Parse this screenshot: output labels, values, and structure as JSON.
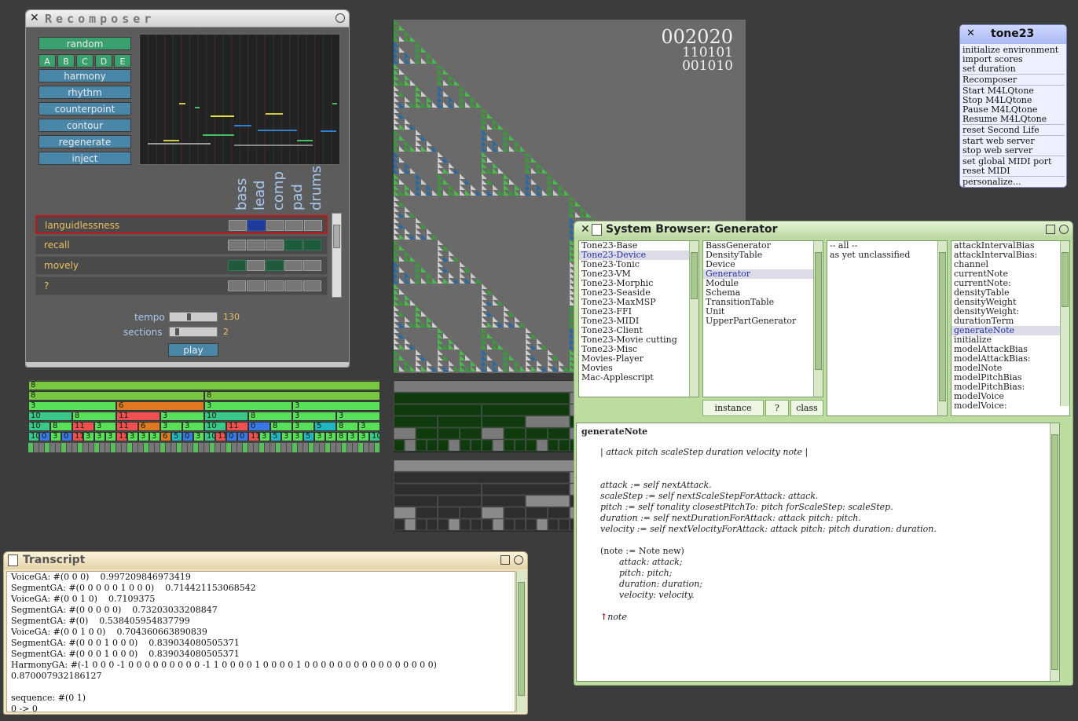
{
  "recomposer": {
    "title": "Recomposer",
    "buttons": [
      "random",
      "harmony",
      "rhythm",
      "counterpoint",
      "contour",
      "regenerate",
      "inject"
    ],
    "letters": [
      "A",
      "B",
      "C",
      "D",
      "E"
    ],
    "instruments": [
      "bass",
      "lead",
      "comp",
      "pad",
      "drums"
    ],
    "tracks": [
      {
        "name": "languidlessness",
        "cells": [
          0,
          2,
          0,
          0,
          0
        ]
      },
      {
        "name": "recall",
        "cells": [
          0,
          0,
          0,
          1,
          1
        ]
      },
      {
        "name": "movely",
        "cells": [
          1,
          0,
          1,
          0,
          0
        ]
      },
      {
        "name": "?",
        "cells": [
          0,
          0,
          0,
          0,
          0
        ]
      }
    ],
    "tempo_label": "tempo",
    "tempo_value": "130",
    "sections_label": "sections",
    "sections_value": "2",
    "play_label": "play",
    "colors": {
      "button_green": "#3aa06e",
      "button_blue": "#4a86a8",
      "value_gold": "#e8c060",
      "label_blue": "#a8c8ee"
    }
  },
  "counter": {
    "line1": "002020",
    "line2": "110101",
    "line3": "001010"
  },
  "segments": {
    "rows": [
      [
        [
          "8",
          448,
          "#78c840"
        ]
      ],
      [
        [
          "8",
          224,
          "#78c840"
        ],
        [
          "8",
          224,
          "#78c840"
        ]
      ],
      [
        [
          "3",
          112,
          "#58e058"
        ],
        [
          "6",
          112,
          "#e07820"
        ],
        [
          "3",
          112,
          "#58e058"
        ],
        [
          "3",
          112,
          "#58e058"
        ]
      ],
      [
        [
          "10",
          56,
          "#38c888"
        ],
        [
          "8",
          56,
          "#58e058"
        ],
        [
          "11",
          56,
          "#f05050"
        ],
        [
          "3",
          56,
          "#58e058"
        ],
        [
          "10",
          56,
          "#38c888"
        ],
        [
          "8",
          56,
          "#58e058"
        ],
        [
          "3",
          56,
          "#58e058"
        ],
        [
          "3",
          56,
          "#58e058"
        ]
      ],
      [
        [
          "10",
          28,
          "#38c888"
        ],
        [
          "8",
          28,
          "#58e058"
        ],
        [
          "11",
          28,
          "#f05050"
        ],
        [
          "3",
          28,
          "#58e058"
        ],
        [
          "11",
          28,
          "#f05050"
        ],
        [
          "6",
          28,
          "#e07820"
        ],
        [
          "3",
          28,
          "#58e058"
        ],
        [
          "3",
          28,
          "#58e058"
        ],
        [
          "10",
          28,
          "#38c888"
        ],
        [
          "11",
          28,
          "#f05050"
        ],
        [
          "0",
          28,
          "#3878e8"
        ],
        [
          "8",
          28,
          "#58e058"
        ],
        [
          "3",
          28,
          "#58e058"
        ],
        [
          "5",
          28,
          "#20b8c0"
        ],
        [
          "8",
          28,
          "#58e058"
        ],
        [
          "3",
          28,
          "#58e058"
        ]
      ],
      [
        [
          "10",
          14,
          "#38c888"
        ],
        [
          "0",
          14,
          "#3878e8"
        ],
        [
          "3",
          14,
          "#58e058"
        ],
        [
          "0",
          14,
          "#3878e8"
        ],
        [
          "11",
          14,
          "#f05050"
        ],
        [
          "3",
          14,
          "#58e058"
        ],
        [
          "3",
          14,
          "#58e058"
        ],
        [
          "3",
          14,
          "#58e058"
        ],
        [
          "11",
          14,
          "#f05050"
        ],
        [
          "3",
          14,
          "#58e058"
        ],
        [
          "3",
          14,
          "#58e058"
        ],
        [
          "3",
          14,
          "#58e058"
        ],
        [
          "6",
          14,
          "#e07820"
        ],
        [
          "5",
          14,
          "#20b8c0"
        ],
        [
          "0",
          14,
          "#3878e8"
        ],
        [
          "3",
          14,
          "#58e058"
        ],
        [
          "10",
          14,
          "#38c888"
        ],
        [
          "11",
          14,
          "#f05050"
        ],
        [
          "0",
          14,
          "#3878e8"
        ],
        [
          "0",
          14,
          "#3878e8"
        ],
        [
          "11",
          14,
          "#f05050"
        ],
        [
          "3",
          14,
          "#58e058"
        ],
        [
          "5",
          14,
          "#20b8c0"
        ],
        [
          "3",
          14,
          "#58e058"
        ],
        [
          "3",
          14,
          "#58e058"
        ],
        [
          "5",
          14,
          "#20b8c0"
        ],
        [
          "3",
          14,
          "#58e058"
        ],
        [
          "3",
          14,
          "#58e058"
        ],
        [
          "8",
          14,
          "#58e058"
        ],
        [
          "3",
          14,
          "#58e058"
        ],
        [
          "3",
          14,
          "#58e058"
        ],
        [
          "10",
          14,
          "#38c888"
        ]
      ]
    ]
  },
  "tone23": {
    "title": "tone23",
    "groups": [
      [
        "initialize environment",
        "import scores",
        "set duration"
      ],
      [
        "Recomposer"
      ],
      [
        "Start M4LQtone",
        "Stop M4LQtone",
        "Pause M4LQtone",
        "Resume M4LQtone"
      ],
      [
        "reset Second Life"
      ],
      [
        "start web server",
        "stop web server"
      ],
      [
        "set global MIDI port",
        "reset MIDI"
      ],
      [
        "personalize..."
      ]
    ]
  },
  "browser": {
    "title": "System Browser: Generator",
    "packages": [
      "Tone23-Base",
      "Tone23-Device",
      "Tone23-Tonic",
      "Tone23-VM",
      "Tone23-Morphic",
      "Tone23-Seaside",
      "Tone23-MaxMSP",
      "Tone23-FFI",
      "Tone23-MIDI",
      "Tone23-Client",
      "Tone23-Movie cutting",
      "Tone23-Misc",
      "Movies-Player",
      "Movies",
      "Mac-Applescript"
    ],
    "packages_selected": 1,
    "classes": [
      "BassGenerator",
      "DensityTable",
      "Device",
      "Generator",
      "Module",
      "Schema",
      "TransitionTable",
      "Unit",
      "UpperPartGenerator"
    ],
    "classes_selected": 3,
    "categories": [
      "-- all --",
      "as yet unclassified"
    ],
    "methods": [
      "attackIntervalBias",
      "attackIntervalBias:",
      "channel",
      "currentNote",
      "currentNote:",
      "densityTable",
      "densityWeight",
      "densityWeight:",
      "durationTerm",
      "generateNote",
      "initialize",
      "modelAttackBias",
      "modelAttackBias:",
      "modelNote",
      "modelPitchBias",
      "modelPitchBias:",
      "modelVoice",
      "modelVoice:"
    ],
    "methods_selected": 9,
    "btn_instance": "instance",
    "btn_help": "?",
    "btn_class": "class",
    "code_method_name": "generateNote",
    "code_temps": "| attack pitch scaleStep duration velocity note |",
    "code_attack_line": "attack := self nextAttack.",
    "code_pitch_line": "scaleStep := self nextScaleStepForAttack: attack.",
    "code_tonality_line": "pitch := self tonality closestPitchTo: pitch forScaleStep: scaleStep.",
    "code_duration_line": "duration := self nextDurationForAttack: attack pitch: pitch.",
    "code_velocity_line": "velocity := self nextVelocityForAttack: attack pitch: pitch duration: duration.",
    "code_note_new": "(note := Note new)",
    "code_setters": [
      "attack: attack;",
      "pitch: pitch;",
      "duration: duration;",
      "velocity: velocity."
    ],
    "code_return": "note",
    "code_return_symbol": "↑"
  },
  "transcript": {
    "title": "Transcript",
    "lines": [
      "VoiceGA: #(0 0 0)    0.997209846973419",
      "SegmentGA: #(0 0 0 0 0 1 0 0 0)    0.714421153068542",
      "VoiceGA: #(0 0 1 0)    0.7109375",
      "SegmentGA: #(0 0 0 0 0)    0.73203033208847",
      "SegmentGA: #(0)    0.538405954837799",
      "VoiceGA: #(0 0 1 0 0)    0.704360663890839",
      "SegmentGA: #(0 0 0 1 0 0 0)    0.839034080505371",
      "SegmentGA: #(0 0 0 1 0 0 0)    0.839034080505371",
      "HarmonyGA: #(-1 0 0 0 -1 0 0 0 0 0 0 0 0 0 -1 1 0 0 0 0 1 0 0 0 0 1 0 0 0 0 0 0 0 0 0 0 0 0 0 0 0 0)",
      "0.870007932186127",
      "",
      "sequence: #(0 1)",
      "0 -> 0"
    ]
  }
}
